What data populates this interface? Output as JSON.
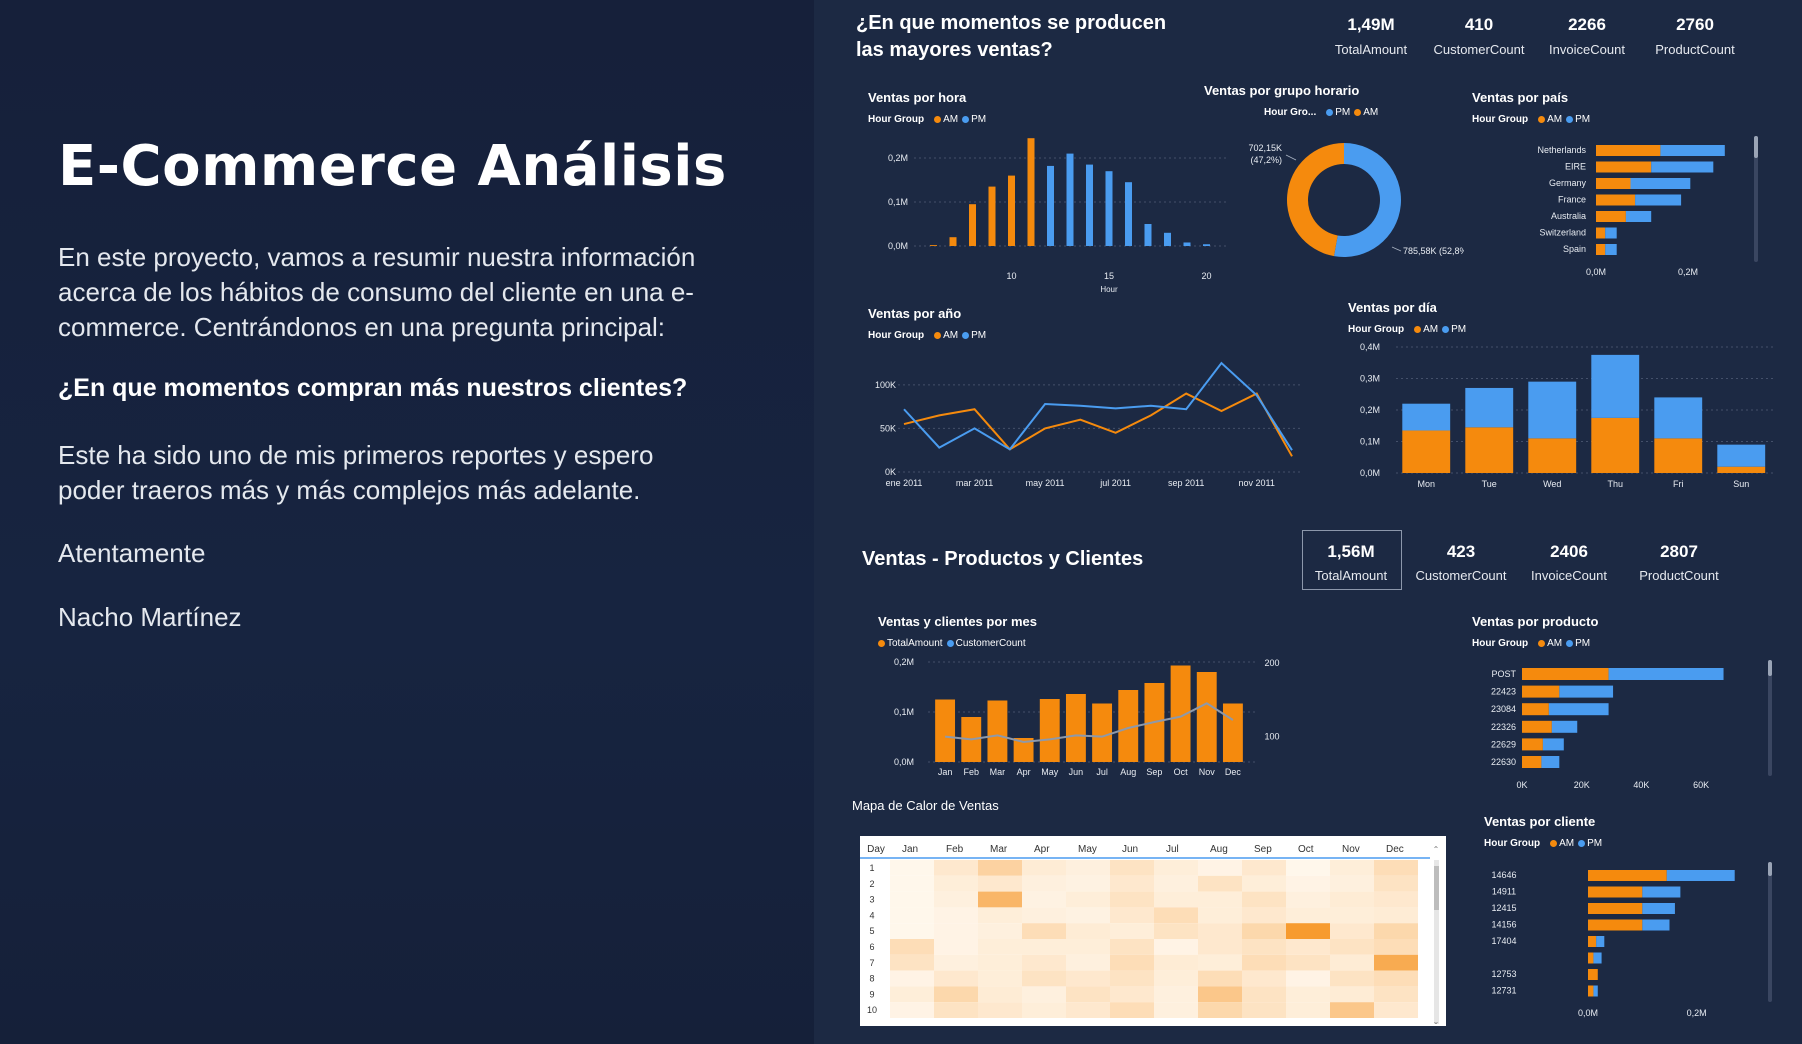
{
  "intro": {
    "title": "E-Commerce Análisis",
    "paragraph": "En este proyecto, vamos a resumir nuestra información acerca de los hábitos de consumo del cliente en una e-commerce. Centrándonos en una pregunta principal:",
    "question": "¿En que momentos compran más nuestros clientes?",
    "closing": "Este ha sido uno de mis primeros reportes y espero poder traeros más y más complejos más adelante.",
    "regards": "Atentamente",
    "author": "Nacho Martínez"
  },
  "colors": {
    "am": "#f58a0d",
    "pm": "#4a9cf0",
    "panel": "#1c2943",
    "background": "#16203a"
  },
  "section1": {
    "title_line1": "¿En que momentos se producen",
    "title_line2": "las mayores ventas?",
    "kpis": [
      {
        "value": "1,49M",
        "label": "TotalAmount"
      },
      {
        "value": "410",
        "label": "CustomerCount"
      },
      {
        "value": "2266",
        "label": "InvoiceCount"
      },
      {
        "value": "2760",
        "label": "ProductCount"
      }
    ]
  },
  "section2": {
    "title": "Ventas - Productos y Clientes",
    "kpis": [
      {
        "value": "1,56M",
        "label": "TotalAmount"
      },
      {
        "value": "423",
        "label": "CustomerCount"
      },
      {
        "value": "2406",
        "label": "InvoiceCount"
      },
      {
        "value": "2807",
        "label": "ProductCount"
      }
    ]
  },
  "legends": {
    "hour_group": "Hour Group",
    "hour_group_short": "Hour Gro...",
    "am": "AM",
    "pm": "PM",
    "total_amount": "TotalAmount",
    "customer_count": "CustomerCount"
  },
  "chart_data": [
    {
      "id": "hour",
      "type": "bar",
      "title": "Ventas por hora",
      "xlabel": "Hour",
      "ylim": [
        0,
        0.25
      ],
      "yticks": [
        "0,0M",
        "0,1M",
        "0,2M"
      ],
      "xticks": [
        "10",
        "15",
        "20"
      ],
      "series": [
        {
          "name": "AM",
          "x": [
            6,
            7,
            8,
            9,
            10,
            11
          ],
          "values": [
            0.002,
            0.02,
            0.095,
            0.135,
            0.16,
            0.245
          ]
        },
        {
          "name": "PM",
          "x": [
            12,
            13,
            14,
            15,
            16,
            17,
            18,
            19,
            20
          ],
          "values": [
            0.182,
            0.21,
            0.185,
            0.17,
            0.145,
            0.05,
            0.03,
            0.008,
            0.004
          ]
        }
      ]
    },
    {
      "id": "group",
      "type": "pie",
      "title": "Ventas por grupo horario",
      "labels": [
        "PM",
        "AM"
      ],
      "values": [
        785.58,
        702.15
      ],
      "data_labels": [
        "785,58K (52,8%)",
        "702,15K",
        "(47,2%)"
      ]
    },
    {
      "id": "country",
      "type": "bar",
      "orientation": "horizontal",
      "title": "Ventas por país",
      "categories": [
        "Netherlands",
        "EIRE",
        "Germany",
        "France",
        "Australia",
        "Switzerland",
        "Spain"
      ],
      "series": [
        {
          "name": "AM",
          "values": [
            0.14,
            0.12,
            0.075,
            0.085,
            0.065,
            0.02,
            0.02
          ]
        },
        {
          "name": "PM",
          "values": [
            0.14,
            0.135,
            0.13,
            0.1,
            0.055,
            0.025,
            0.025
          ]
        }
      ],
      "xlim": [
        0,
        0.3
      ],
      "xticks": [
        "0,0M",
        "0,2M"
      ]
    },
    {
      "id": "year",
      "type": "line",
      "title": "Ventas por año",
      "x": [
        "ene 2011",
        "feb 2011",
        "mar 2011",
        "abr 2011",
        "may 2011",
        "jun 2011",
        "jul 2011",
        "ago 2011",
        "sep 2011",
        "oct 2011",
        "nov 2011",
        "dic 2011"
      ],
      "xticks": [
        "ene 2011",
        "mar 2011",
        "may 2011",
        "jul 2011",
        "sep 2011",
        "nov 2011"
      ],
      "ylim": [
        0,
        140000
      ],
      "yticks": [
        "0K",
        "50K",
        "100K"
      ],
      "series": [
        {
          "name": "AM",
          "values": [
            55000,
            65000,
            72000,
            26000,
            50000,
            60000,
            45000,
            65000,
            90000,
            70000,
            90000,
            18000
          ]
        },
        {
          "name": "PM",
          "values": [
            72000,
            28000,
            50000,
            26000,
            78000,
            76000,
            73000,
            76000,
            72000,
            125000,
            88000,
            25000
          ]
        }
      ]
    },
    {
      "id": "day",
      "type": "bar",
      "stacked": true,
      "title": "Ventas por día",
      "categories": [
        "Mon",
        "Tue",
        "Wed",
        "Thu",
        "Fri",
        "Sun"
      ],
      "ylim": [
        0,
        0.4
      ],
      "yticks": [
        "0,0M",
        "0,1M",
        "0,2M",
        "0,3M",
        "0,4M"
      ],
      "series": [
        {
          "name": "AM",
          "values": [
            0.135,
            0.145,
            0.11,
            0.175,
            0.11,
            0.02
          ]
        },
        {
          "name": "PM",
          "values": [
            0.085,
            0.125,
            0.18,
            0.2,
            0.13,
            0.07
          ]
        }
      ]
    },
    {
      "id": "month",
      "type": "bar",
      "title": "Ventas y clientes por mes",
      "categories": [
        "Jan",
        "Feb",
        "Mar",
        "Apr",
        "May",
        "Jun",
        "Jul",
        "Aug",
        "Sep",
        "Oct",
        "Nov",
        "Dec"
      ],
      "ylim": [
        0,
        0.2
      ],
      "yticks": [
        "0,0M",
        "0,1M",
        "0,2M"
      ],
      "y2lim": [
        50,
        200
      ],
      "y2ticks": [
        "100",
        "200"
      ],
      "series": [
        {
          "name": "TotalAmount",
          "values": [
            0.125,
            0.09,
            0.123,
            0.048,
            0.126,
            0.136,
            0.117,
            0.144,
            0.158,
            0.193,
            0.18,
            0.117
          ]
        },
        {
          "name": "CustomerCount",
          "type": "line",
          "values": [
            100,
            96,
            102,
            92,
            96,
            102,
            100,
            113,
            122,
            130,
            150,
            125
          ]
        }
      ]
    },
    {
      "id": "product",
      "type": "bar",
      "orientation": "horizontal",
      "title": "Ventas por producto",
      "categories": [
        "POST",
        "22423",
        "23084",
        "22326",
        "22629",
        "22630"
      ],
      "xlim": [
        0,
        70000
      ],
      "xticks": [
        "0K",
        "20K",
        "40K",
        "60K"
      ],
      "series": [
        {
          "name": "AM",
          "values": [
            29000,
            12500,
            9000,
            10000,
            7000,
            6500
          ]
        },
        {
          "name": "PM",
          "values": [
            38500,
            18000,
            20000,
            8500,
            7000,
            6000
          ]
        }
      ]
    },
    {
      "id": "client",
      "type": "bar",
      "orientation": "horizontal",
      "title": "Ventas por cliente",
      "categories": [
        "14646",
        "14911",
        "12415",
        "14156",
        "17404",
        "",
        "12753",
        "12731"
      ],
      "xlim": [
        0,
        0.3
      ],
      "xticks": [
        "0,0M",
        "0,2M"
      ],
      "series": [
        {
          "name": "AM",
          "values": [
            0.145,
            0.1,
            0.1,
            0.1,
            0.015,
            0.01,
            0.018,
            0.01
          ],
          "note": ""
        },
        {
          "name": "PM",
          "values": [
            0.125,
            0.07,
            0.06,
            0.05,
            0.015,
            0.015,
            0,
            0.008
          ]
        }
      ]
    },
    {
      "id": "heatmap",
      "type": "heatmap",
      "title": "Mapa de Calor de Ventas",
      "row_header": "Day",
      "columns": [
        "Jan",
        "Feb",
        "Mar",
        "Apr",
        "May",
        "Jun",
        "Jul",
        "Aug",
        "Sep",
        "Oct",
        "Nov",
        "Dec"
      ],
      "rows": [
        "1",
        "2",
        "3",
        "4",
        "5",
        "6",
        "7",
        "8",
        "9",
        "10"
      ],
      "values": [
        [
          0.02,
          0.15,
          0.35,
          0.12,
          0.08,
          0.2,
          0.1,
          0.05,
          0.15,
          0.02,
          0.1,
          0.25
        ],
        [
          0.02,
          0.1,
          0.15,
          0.08,
          0.06,
          0.15,
          0.08,
          0.2,
          0.1,
          0.05,
          0.08,
          0.2
        ],
        [
          0.02,
          0.08,
          0.6,
          0.06,
          0.1,
          0.2,
          0.1,
          0.1,
          0.2,
          0.08,
          0.12,
          0.15
        ],
        [
          0.02,
          0.05,
          0.1,
          0.08,
          0.06,
          0.15,
          0.25,
          0.1,
          0.15,
          0.1,
          0.1,
          0.12
        ],
        [
          0.02,
          0.05,
          0.08,
          0.25,
          0.12,
          0.1,
          0.2,
          0.15,
          0.3,
          0.85,
          0.15,
          0.3
        ],
        [
          0.25,
          0.05,
          0.1,
          0.1,
          0.1,
          0.2,
          0.05,
          0.15,
          0.2,
          0.15,
          0.2,
          0.25
        ],
        [
          0.2,
          0.08,
          0.1,
          0.15,
          0.08,
          0.25,
          0.12,
          0.1,
          0.25,
          0.2,
          0.12,
          0.7
        ],
        [
          0.05,
          0.15,
          0.1,
          0.2,
          0.15,
          0.2,
          0.1,
          0.25,
          0.15,
          0.05,
          0.2,
          0.25
        ],
        [
          0.1,
          0.3,
          0.12,
          0.08,
          0.2,
          0.15,
          0.08,
          0.45,
          0.2,
          0.1,
          0.12,
          0.2
        ],
        [
          0.05,
          0.2,
          0.15,
          0.1,
          0.15,
          0.25,
          0.08,
          0.3,
          0.2,
          0.1,
          0.45,
          0.15
        ]
      ]
    }
  ]
}
